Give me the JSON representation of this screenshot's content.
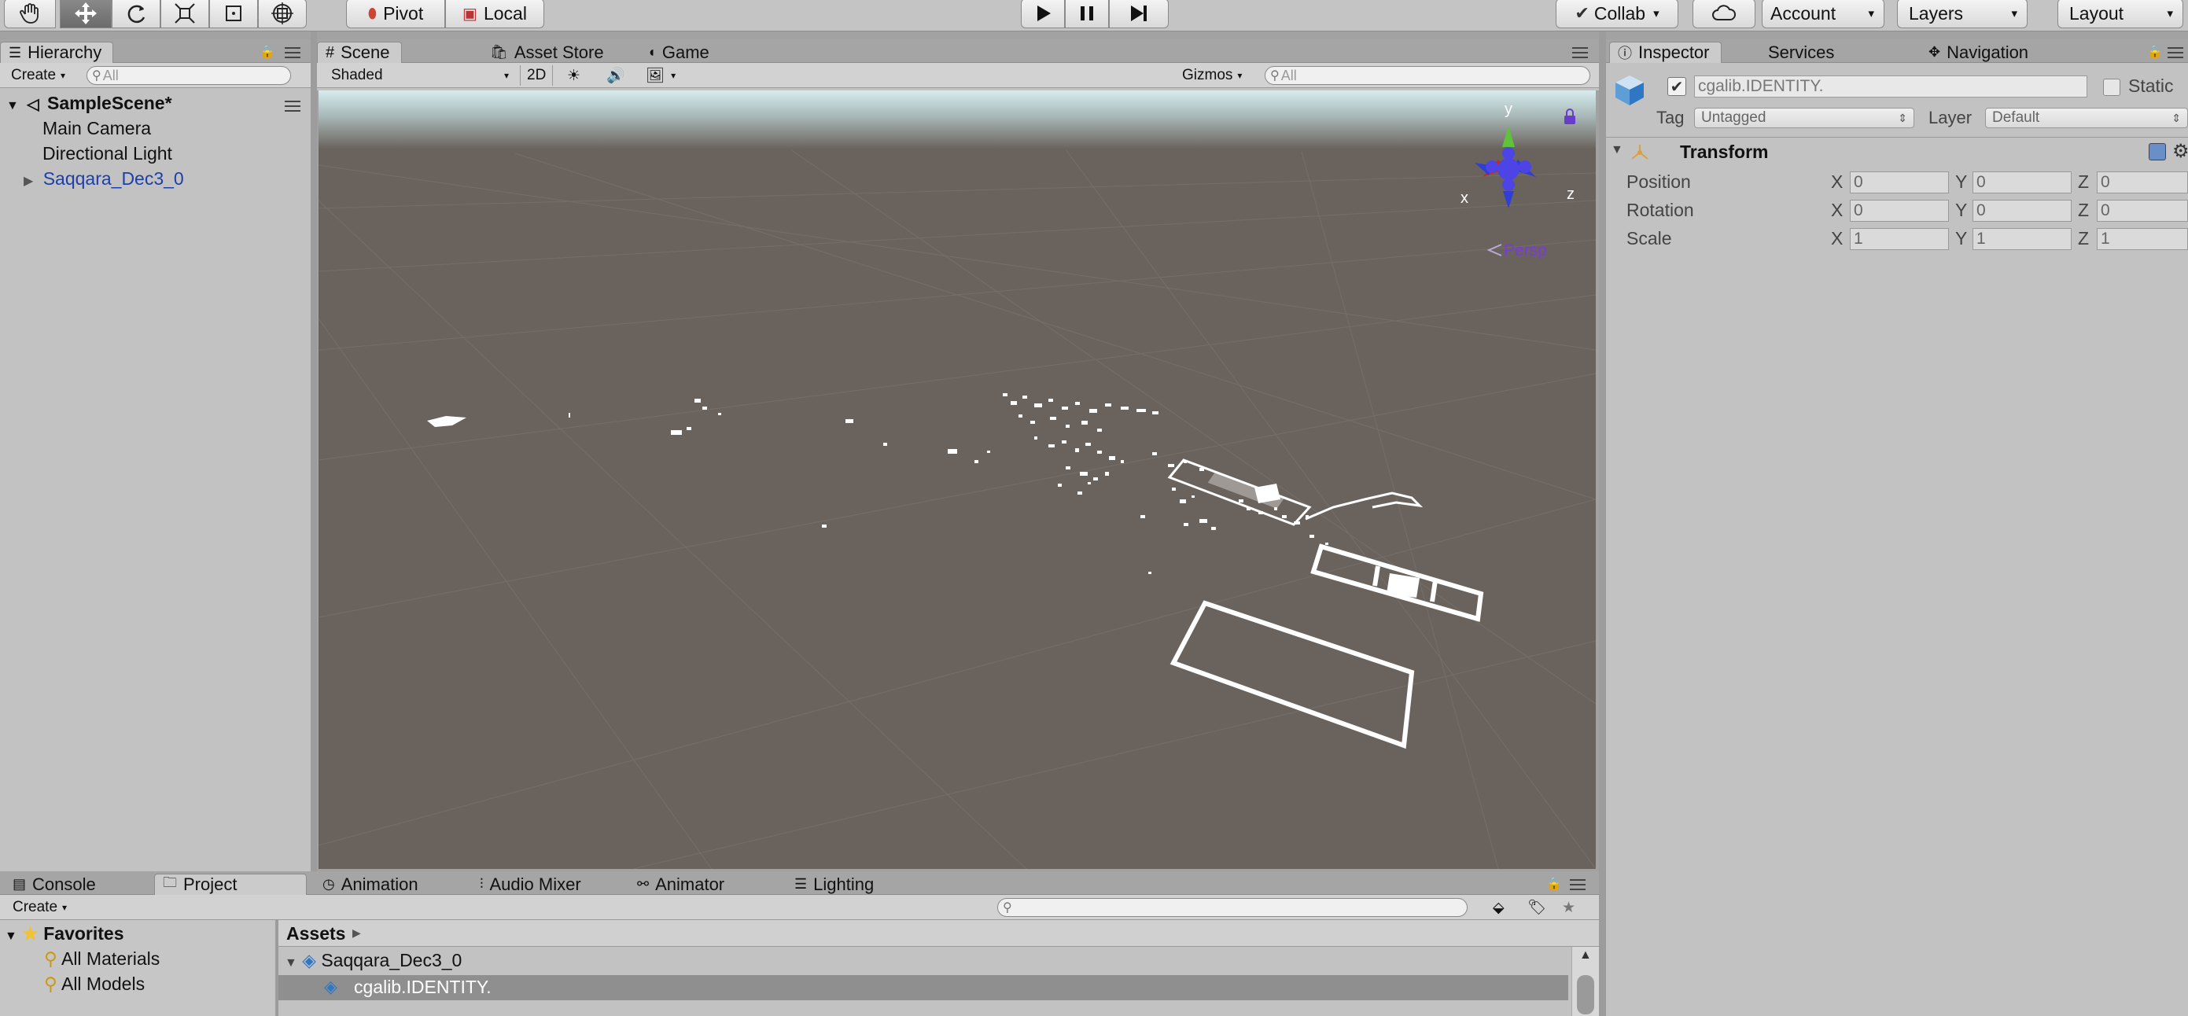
{
  "toolbar": {
    "pivot_label": "Pivot",
    "local_label": "Local",
    "collab_label": "Collab",
    "account_label": "Account",
    "layers_label": "Layers",
    "layout_label": "Layout"
  },
  "hierarchy": {
    "tab_label": "Hierarchy",
    "create_label": "Create",
    "search_placeholder": "All",
    "scene_name": "SampleScene*",
    "items": [
      {
        "label": "Main Camera"
      },
      {
        "label": "Directional Light"
      },
      {
        "label": "Saqqara_Dec3_0"
      }
    ]
  },
  "scene": {
    "tabs": [
      {
        "label": "Scene"
      },
      {
        "label": "Asset Store"
      },
      {
        "label": "Game"
      }
    ],
    "shading_mode": "Shaded",
    "mode_2d": "2D",
    "gizmos_label": "Gizmos",
    "search_placeholder": "All",
    "gizmo_axes": {
      "x": "x",
      "y": "y",
      "z": "z"
    },
    "projection_label": "Persp",
    "colors": {
      "sky": "#cfe7ea",
      "ground": "#6a625c",
      "x_axis": "#c8281e",
      "y_axis": "#5fc23a",
      "z_axis": "#2e3fd8",
      "persp": "#7a3cd8"
    }
  },
  "inspector": {
    "tabs": [
      {
        "label": "Inspector"
      },
      {
        "label": "Services"
      },
      {
        "label": "Navigation"
      }
    ],
    "object_name": "cgalib.IDENTITY.",
    "static_label": "Static",
    "tag_label": "Tag",
    "tag_value": "Untagged",
    "layer_label": "Layer",
    "layer_value": "Default",
    "transform_title": "Transform",
    "rows": [
      {
        "label": "Position",
        "x": "0",
        "y": "0",
        "z": "0"
      },
      {
        "label": "Rotation",
        "x": "0",
        "y": "0",
        "z": "0"
      },
      {
        "label": "Scale",
        "x": "1",
        "y": "1",
        "z": "1"
      }
    ],
    "axis_x": "X",
    "axis_y": "Y",
    "axis_z": "Z"
  },
  "bottom": {
    "tabs": [
      {
        "label": "Console"
      },
      {
        "label": "Project"
      },
      {
        "label": "Animation"
      },
      {
        "label": "Audio Mixer"
      },
      {
        "label": "Animator"
      },
      {
        "label": "Lighting"
      }
    ],
    "create_label": "Create",
    "favorites_label": "Favorites",
    "favorites": [
      {
        "label": "All Materials"
      },
      {
        "label": "All Models"
      }
    ],
    "assets_label": "Assets",
    "asset_items": [
      {
        "label": "Saqqara_Dec3_0"
      },
      {
        "label": "cgalib.IDENTITY."
      }
    ]
  }
}
